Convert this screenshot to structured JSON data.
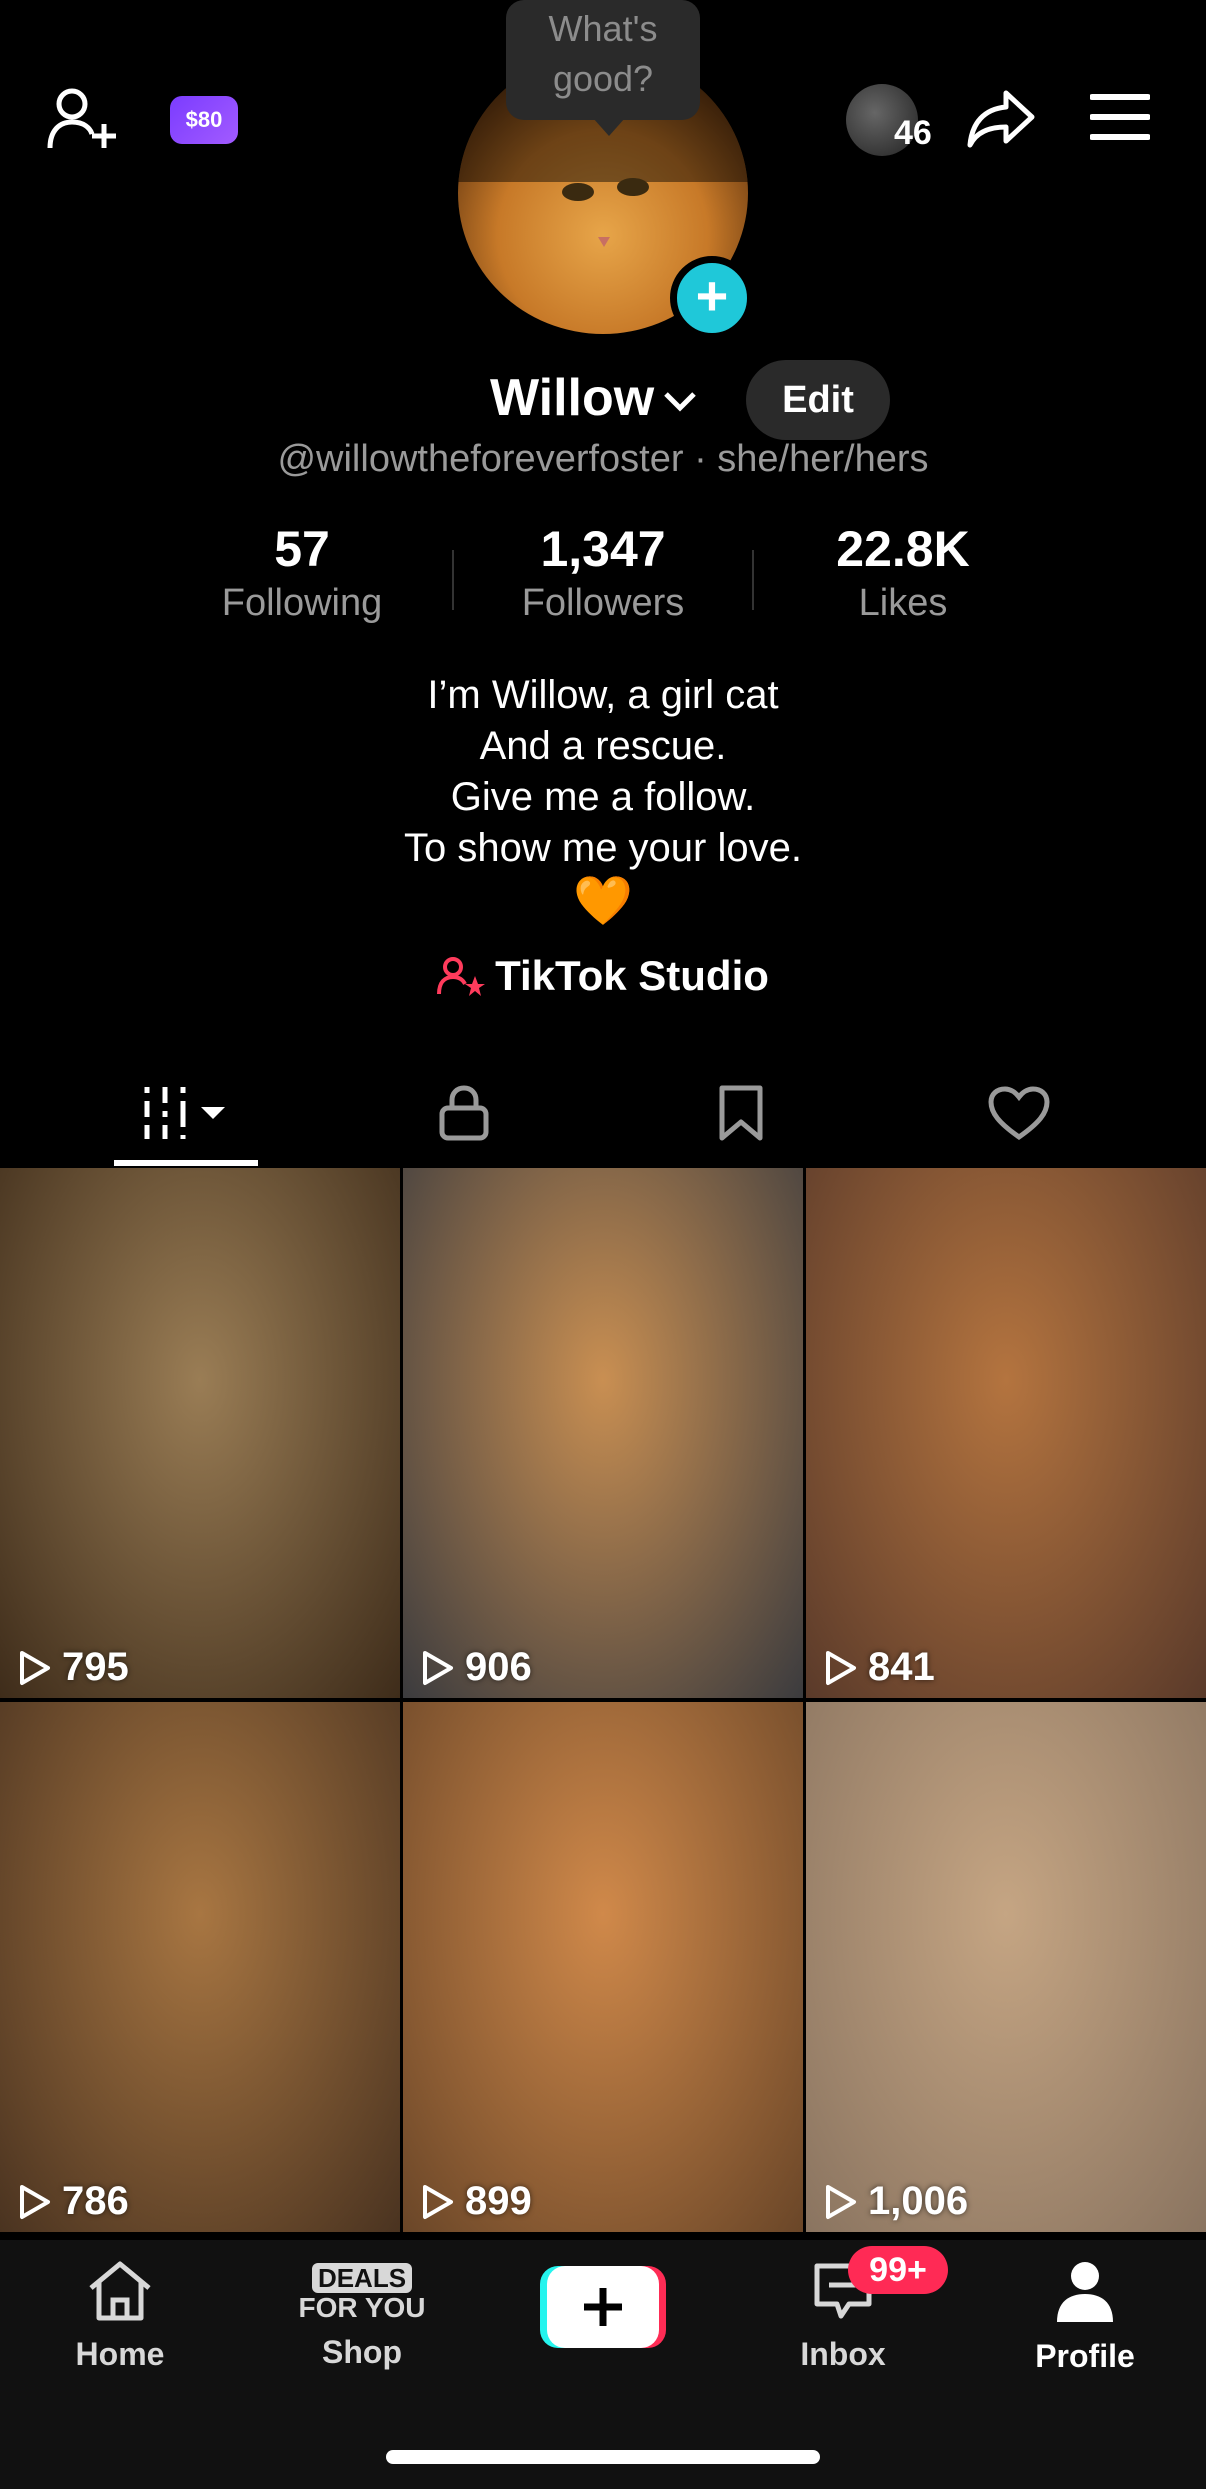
{
  "top": {
    "coin_label": "$80",
    "avatar_count": "46",
    "tooltip": "What's good?"
  },
  "profile": {
    "name": "Willow",
    "edit_label": "Edit",
    "handle": "@willowtheforeverfoster · she/her/hers",
    "stats": [
      {
        "value": "57",
        "label": "Following"
      },
      {
        "value": "1,347",
        "label": "Followers"
      },
      {
        "value": "22.8K",
        "label": "Likes"
      }
    ],
    "bio_lines": [
      "I’m Willow, a girl cat",
      "And a rescue.",
      "Give me a follow.",
      "To show me your love."
    ],
    "bio_emoji": "🧡",
    "studio_label": "TikTok Studio"
  },
  "tabs": [
    "videos-grid",
    "private",
    "saved",
    "liked"
  ],
  "videos": [
    {
      "views": "795",
      "tone": [
        "#9a7d55",
        "#3e2c1a"
      ]
    },
    {
      "views": "906",
      "tone": [
        "#c98f52",
        "#3b3b3e"
      ]
    },
    {
      "views": "841",
      "tone": [
        "#b4743f",
        "#5a3a2a"
      ]
    },
    {
      "views": "786",
      "tone": [
        "#a87642",
        "#4a3320"
      ]
    },
    {
      "views": "899",
      "tone": [
        "#d0894a",
        "#6a4628"
      ]
    },
    {
      "views": "1,006",
      "tone": [
        "#c5a583",
        "#8a7460"
      ]
    }
  ],
  "nav": {
    "home": "Home",
    "shop": "Shop",
    "shop_badge_top": "DEALS",
    "shop_badge_bottom": "FOR YOU",
    "inbox": "Inbox",
    "inbox_badge": "99+",
    "profile": "Profile"
  }
}
